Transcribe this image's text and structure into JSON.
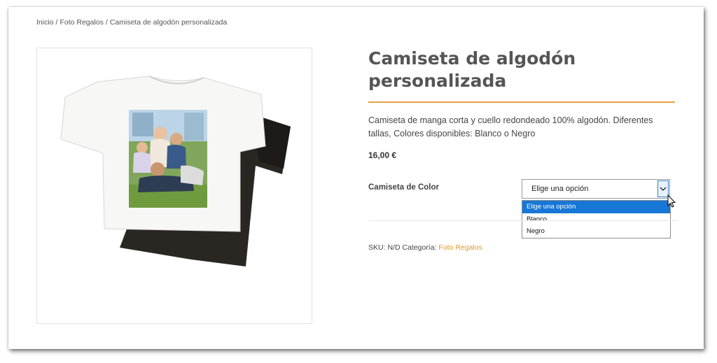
{
  "breadcrumb": {
    "items": [
      "Inicio",
      "Foto Regalos",
      "Camiseta de algodón personalizada"
    ],
    "separator": "/"
  },
  "product": {
    "title_line1": "Camiseta de algodón",
    "title_line2": "personalizada",
    "description": "Camiseta de manga corta y cuello redondeado 100% algodón. Diferentes tallas, Colores disponibles: Blanco o Negro",
    "price": "16,00 €",
    "option_label": "Camiseta de Color",
    "select": {
      "value": "Elige una opción",
      "options": [
        "Elige una opción",
        "Blanco",
        "Negro"
      ],
      "selected_index": 0
    },
    "sku_label": "SKU:",
    "sku_value": "N/D",
    "category_label": "Categoría:",
    "category_link": "Foto Regalos"
  },
  "colors": {
    "accent": "#e7a33e",
    "link": "#e09a2e",
    "selection": "#1777d6",
    "title": "#555555"
  }
}
